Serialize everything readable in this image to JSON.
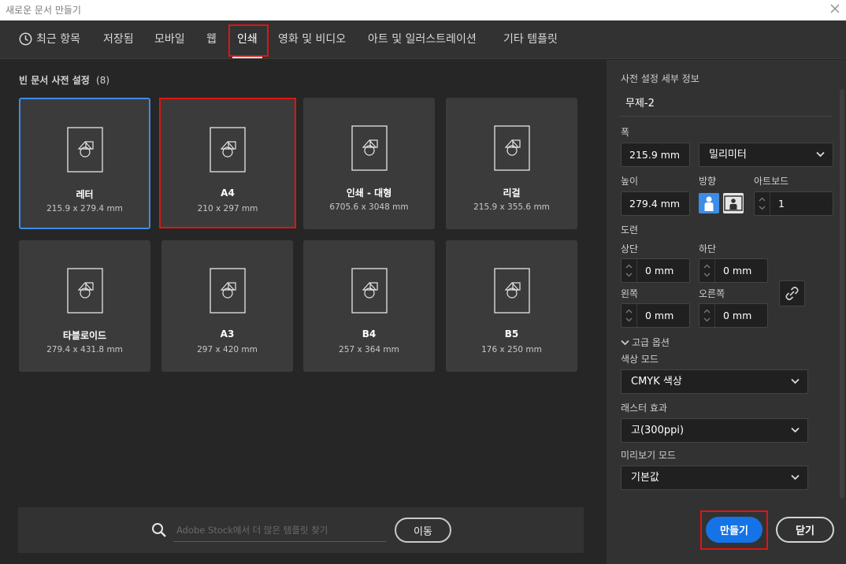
{
  "window": {
    "title": "새로운 문서 만들기"
  },
  "tabs": [
    {
      "label": "최근 항목"
    },
    {
      "label": "저장됨"
    },
    {
      "label": "모바일"
    },
    {
      "label": "웹"
    },
    {
      "label": "인쇄",
      "active": true
    },
    {
      "label": "영화 및 비디오"
    },
    {
      "label": "아트 및 일러스트레이션"
    },
    {
      "label": "기타 템플릿"
    }
  ],
  "presets": {
    "title": "빈 문서 사전 설정",
    "count": "(8)",
    "items": [
      {
        "name": "레터",
        "dims": "215.9 x 279.4 mm",
        "selected": true
      },
      {
        "name": "A4",
        "dims": "210 x 297 mm"
      },
      {
        "name": "인쇄 - 대형",
        "dims": "6705.6 x 3048 mm"
      },
      {
        "name": "리걸",
        "dims": "215.9 x 355.6 mm"
      },
      {
        "name": "타블로이드",
        "dims": "279.4 x 431.8 mm"
      },
      {
        "name": "A3",
        "dims": "297 x 420 mm"
      },
      {
        "name": "B4",
        "dims": "257 x 364 mm"
      },
      {
        "name": "B5",
        "dims": "176 x 250 mm"
      }
    ]
  },
  "search": {
    "placeholder": "Adobe Stock에서 더 많은 템플릿 찾기",
    "go_label": "이동"
  },
  "details": {
    "heading": "사전 설정 세부 정보",
    "doc_name": "무제-2",
    "width_label": "폭",
    "width_value": "215.9 mm",
    "unit_value": "밀리미터",
    "height_label": "높이",
    "height_value": "279.4 mm",
    "orientation_label": "방향",
    "artboard_label": "아트보드",
    "artboard_value": "1",
    "bleed_label": "도련",
    "top_label": "상단",
    "top_value": "0 mm",
    "bottom_label": "하단",
    "bottom_value": "0 mm",
    "left_label": "왼쪽",
    "left_value": "0 mm",
    "right_label": "오른쪽",
    "right_value": "0 mm",
    "advanced_label": "고급 옵션",
    "color_mode_label": "색상 모드",
    "color_mode_value": "CMYK 색상",
    "raster_label": "래스터 효과",
    "raster_value": "고(300ppi)",
    "preview_label": "미리보기 모드",
    "preview_value": "기본값"
  },
  "actions": {
    "create_label": "만들기",
    "close_label": "닫기"
  },
  "colors": {
    "accent": "#1473e6",
    "selection": "#3d8ce6",
    "highlight_box": "#e01414"
  }
}
